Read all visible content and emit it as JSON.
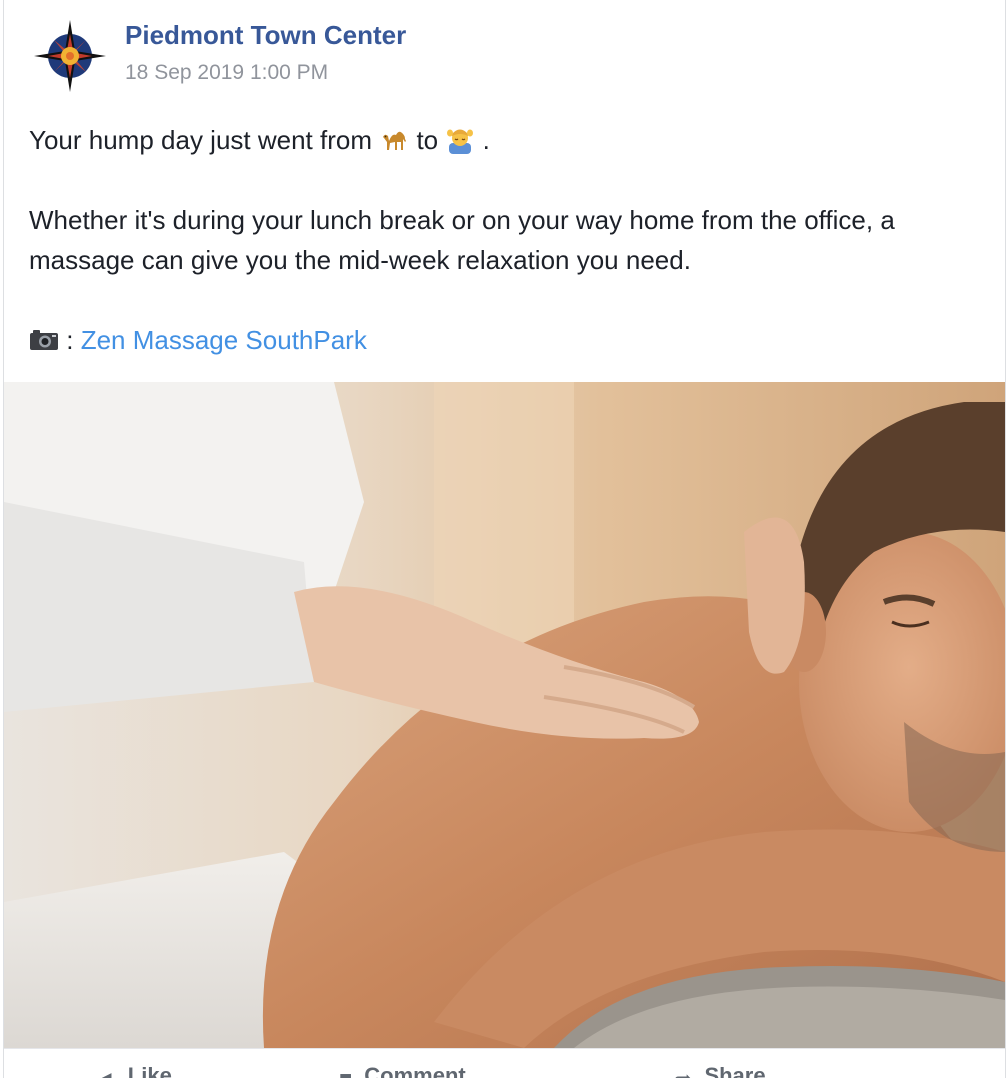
{
  "post": {
    "page_name": "Piedmont Town Center",
    "timestamp": "18 Sep 2019 1:00 PM",
    "logo_icon": "compass-rose-logo",
    "text": {
      "line1_before": "Your hump day just went from ",
      "emoji1": "camel-emoji",
      "line1_mid": "  to ",
      "emoji2": "face-massage-emoji",
      "line1_end": " .",
      "paragraph2": "Whether it's during your lunch break or on your way home from the office, a massage can give you the mid-week relaxation you need.",
      "credit_icon": "camera-icon",
      "credit_sep": " : ",
      "credit_link": "Zen Massage SouthPark"
    },
    "photo": {
      "description_icon": "massage-photo"
    },
    "actions": [
      {
        "label": "Like",
        "icon": "like-icon"
      },
      {
        "label": "Comment",
        "icon": "comment-icon"
      },
      {
        "label": "Share",
        "icon": "share-icon"
      }
    ]
  },
  "colors": {
    "page_name": "#385898",
    "timestamp": "#90949c",
    "body_text": "#1d2129",
    "link": "#4290e3"
  }
}
